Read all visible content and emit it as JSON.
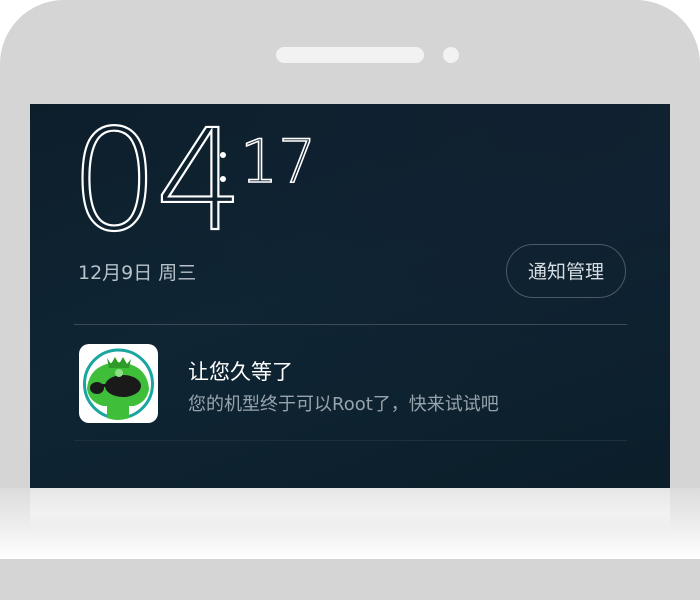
{
  "lockscreen": {
    "clock": {
      "hours": "04",
      "minutes": "17"
    },
    "date": "12月9日 周三",
    "notification_manage_label": "通知管理"
  },
  "notification": {
    "app_icon": "green-monster-app-icon",
    "title": "让您久等了",
    "body": "您的机型终于可以Root了，快来试试吧"
  },
  "colors": {
    "screen_bg": "#0f2534",
    "phone_frame": "#d5d5d5",
    "icon_green": "#3fbe3a",
    "icon_ring": "#1aa6a0"
  }
}
